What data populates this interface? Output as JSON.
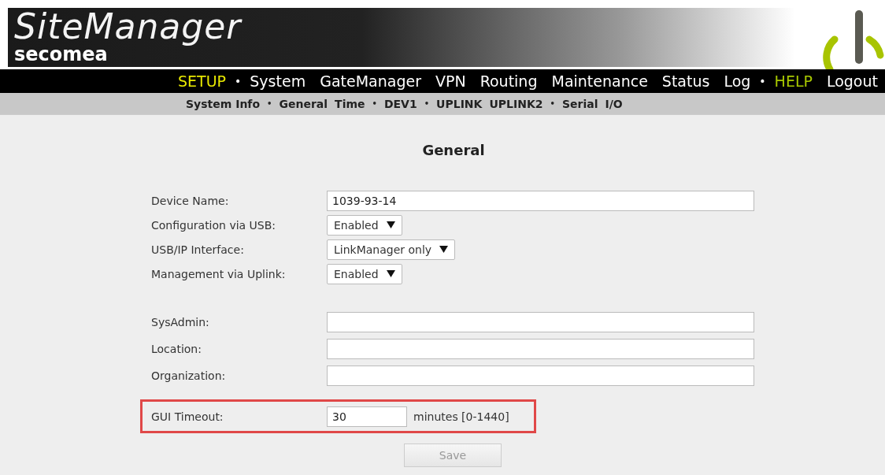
{
  "brand": {
    "product": "SiteManager",
    "company": "secomea"
  },
  "menu": [
    {
      "label": "SETUP",
      "kind": "section",
      "color": "#e8e800"
    },
    {
      "label": "•",
      "kind": "bullet"
    },
    {
      "label": "System",
      "kind": "link"
    },
    {
      "label": "GateManager",
      "kind": "link"
    },
    {
      "label": "VPN",
      "kind": "link"
    },
    {
      "label": "Routing",
      "kind": "link"
    },
    {
      "label": "Maintenance",
      "kind": "link"
    },
    {
      "label": "Status",
      "kind": "link"
    },
    {
      "label": "Log",
      "kind": "link"
    },
    {
      "label": "•",
      "kind": "bullet"
    },
    {
      "label": "HELP",
      "kind": "section",
      "color": "#a8c800"
    },
    {
      "label": "Logout",
      "kind": "link"
    }
  ],
  "submenu": [
    {
      "label": "System Info",
      "kind": "link"
    },
    {
      "label": "•",
      "kind": "bullet"
    },
    {
      "label": "General",
      "kind": "link"
    },
    {
      "label": "Time",
      "kind": "link"
    },
    {
      "label": "•",
      "kind": "bullet"
    },
    {
      "label": "DEV1",
      "kind": "link"
    },
    {
      "label": "•",
      "kind": "bullet"
    },
    {
      "label": "UPLINK",
      "kind": "link"
    },
    {
      "label": "UPLINK2",
      "kind": "link"
    },
    {
      "label": "•",
      "kind": "bullet"
    },
    {
      "label": "Serial",
      "kind": "link"
    },
    {
      "label": "I/O",
      "kind": "link"
    }
  ],
  "page_title": "General",
  "groups": [
    {
      "fields": [
        {
          "label": "Device Name:",
          "kind": "text",
          "value": "1039-93-14"
        },
        {
          "label": "Configuration via USB:",
          "kind": "select",
          "value": "Enabled"
        },
        {
          "label": "USB/IP Interface:",
          "kind": "select",
          "value": "LinkManager only"
        },
        {
          "label": "Management via Uplink:",
          "kind": "select",
          "value": "Enabled"
        }
      ]
    },
    {
      "fields": [
        {
          "label": "SysAdmin:",
          "kind": "text"
        },
        {
          "label": "Location:",
          "kind": "text"
        },
        {
          "label": "Organization:",
          "kind": "text"
        }
      ]
    }
  ],
  "timeout": {
    "label": "GUI Timeout:",
    "value": "30",
    "unit": "minutes [0-1440]",
    "highlighted": true
  },
  "save_button": {
    "label": "Save",
    "disabled": true
  }
}
